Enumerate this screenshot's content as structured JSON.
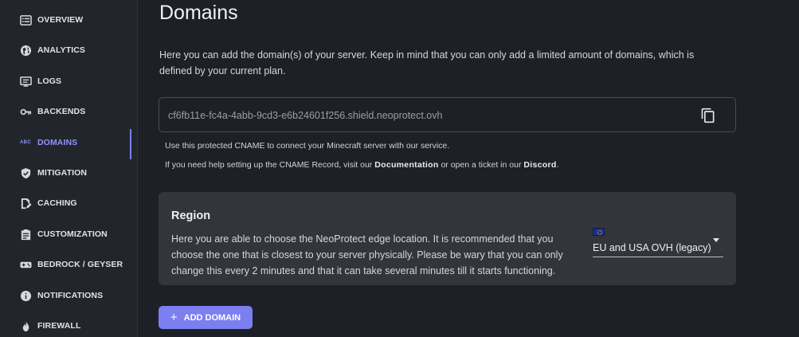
{
  "sidebar": {
    "items": [
      {
        "label": "OVERVIEW",
        "icon": "list-icon"
      },
      {
        "label": "ANALYTICS",
        "icon": "globe-icon"
      },
      {
        "label": "LOGS",
        "icon": "logs-icon"
      },
      {
        "label": "BACKENDS",
        "icon": "key-icon"
      },
      {
        "label": "DOMAINS",
        "icon": "abc-icon",
        "icon_text": "ABC",
        "active": true
      },
      {
        "label": "MITIGATION",
        "icon": "shield-icon"
      },
      {
        "label": "CACHING",
        "icon": "cache-edit-icon"
      },
      {
        "label": "CUSTOMIZATION",
        "icon": "clipboard-icon"
      },
      {
        "label": "BEDROCK / GEYSER",
        "icon": "gamepad-icon"
      },
      {
        "label": "NOTIFICATIONS",
        "icon": "info-icon"
      },
      {
        "label": "FIREWALL",
        "icon": "fire-icon"
      }
    ]
  },
  "main": {
    "title": "Domains",
    "description": "Here you can add the domain(s) of your server. Keep in mind that you can only add a limited amount of domains, which is defined by your current plan.",
    "cname": {
      "value": "cf6fb11e-fc4a-4abb-9cd3-e6b24601f256.shield.neoprotect.ovh",
      "copy_icon": "copy-icon"
    },
    "hint1": "Use this protected CNAME to connect your Minecraft server with our service.",
    "hint2": {
      "before": "If you need help setting up the CNAME Record, visit our ",
      "doc_link": "Documentation",
      "middle": " or open a ticket in our ",
      "discord_link": "Discord",
      "after": "."
    },
    "region": {
      "title": "Region",
      "description": "Here you are able to choose the NeoProtect edge location. It is recommended that you choose the one that is closest to your server physically. Please be wary that you can only change this every 2 minutes and that it can take several minutes till it starts functioning.",
      "selected": "EU and USA OVH (legacy)",
      "flag_icon": "eu-flag-icon"
    },
    "add_button": {
      "label": "ADD DOMAIN",
      "icon": "plus-icon"
    }
  },
  "colors": {
    "background": "#1e2027",
    "sidebar": "#23252d",
    "card": "#33353d",
    "accent": "#7b7ff0",
    "active_text": "#8f93f7"
  }
}
